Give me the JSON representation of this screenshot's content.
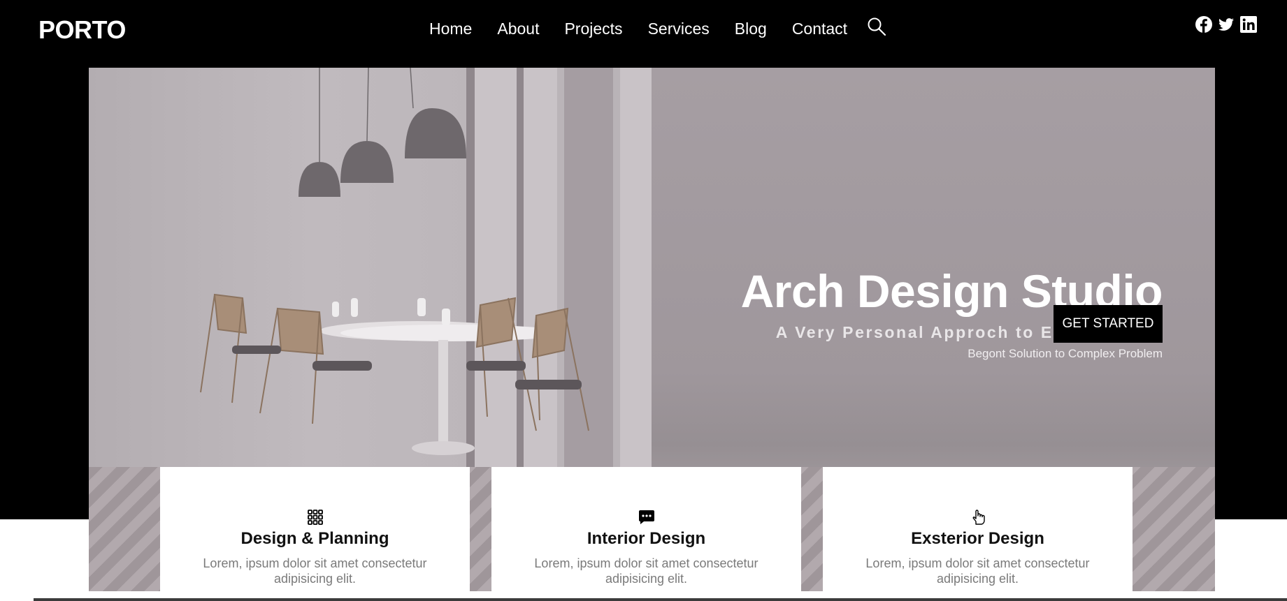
{
  "header": {
    "logo": "PORTO",
    "nav": [
      "Home",
      "About",
      "Projects",
      "Services",
      "Blog",
      "Contact"
    ],
    "icons": [
      "search-icon",
      "facebook-icon",
      "twitter-icon",
      "linkedin-icon"
    ]
  },
  "hero": {
    "title": "Arch Design Studio",
    "subtitle": "A Very Personal Approch to Every Client",
    "description": "Begont Solution to Complex Problem",
    "cta": "GET STARTED"
  },
  "cards": [
    {
      "icon": "grid-icon",
      "title": "Design & Planning",
      "text": "Lorem, ipsum dolor sit amet consectetur adipisicing elit."
    },
    {
      "icon": "chat-icon",
      "title": "Interior Design",
      "text": "Lorem, ipsum dolor sit amet consectetur adipisicing elit."
    },
    {
      "icon": "hand-pointer-icon",
      "title": "Exsterior Design",
      "text": "Lorem, ipsum dolor sit amet consectetur adipisicing elit."
    }
  ],
  "colors": {
    "header_bg": "#000000",
    "button_bg": "#000000",
    "text_muted": "#7a7a7a"
  }
}
